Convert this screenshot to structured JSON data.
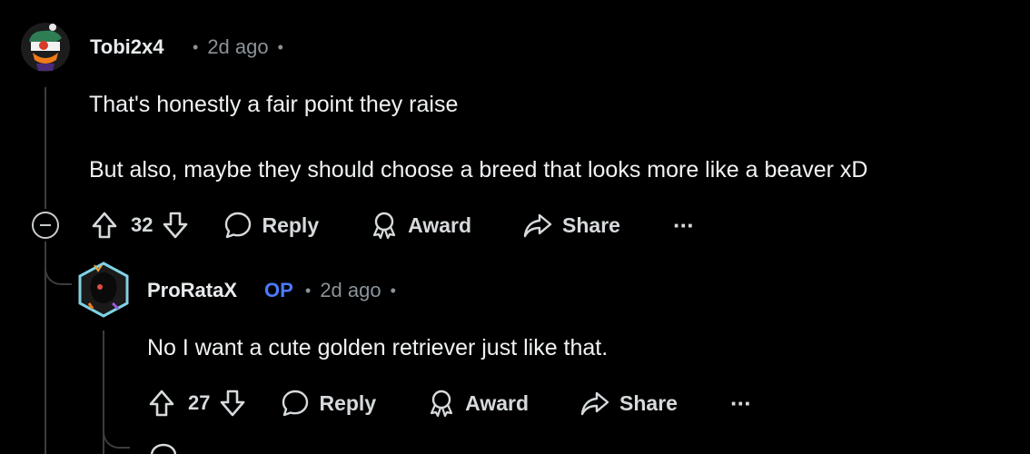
{
  "comments": [
    {
      "username": "Tobi2x4",
      "time": "2d ago",
      "paragraphs": [
        "That's honestly a fair point they raise",
        "But also, maybe they should choose a breed that looks more like a beaver xD"
      ],
      "votes": "32",
      "reply_label": "Reply",
      "award_label": "Award",
      "share_label": "Share",
      "more_label": "···"
    },
    {
      "username": "ProRataX",
      "badge": "OP",
      "time": "2d ago",
      "paragraphs": [
        "No I want a cute golden retriever just like that."
      ],
      "votes": "27",
      "reply_label": "Reply",
      "award_label": "Award",
      "share_label": "Share",
      "more_label": "···"
    }
  ],
  "meta_separator": "•",
  "colors": {
    "background": "#000000",
    "text": "#e8ebed",
    "muted": "#8a9399",
    "op_badge": "#4c79ff",
    "thread_line": "#3a3d40"
  }
}
